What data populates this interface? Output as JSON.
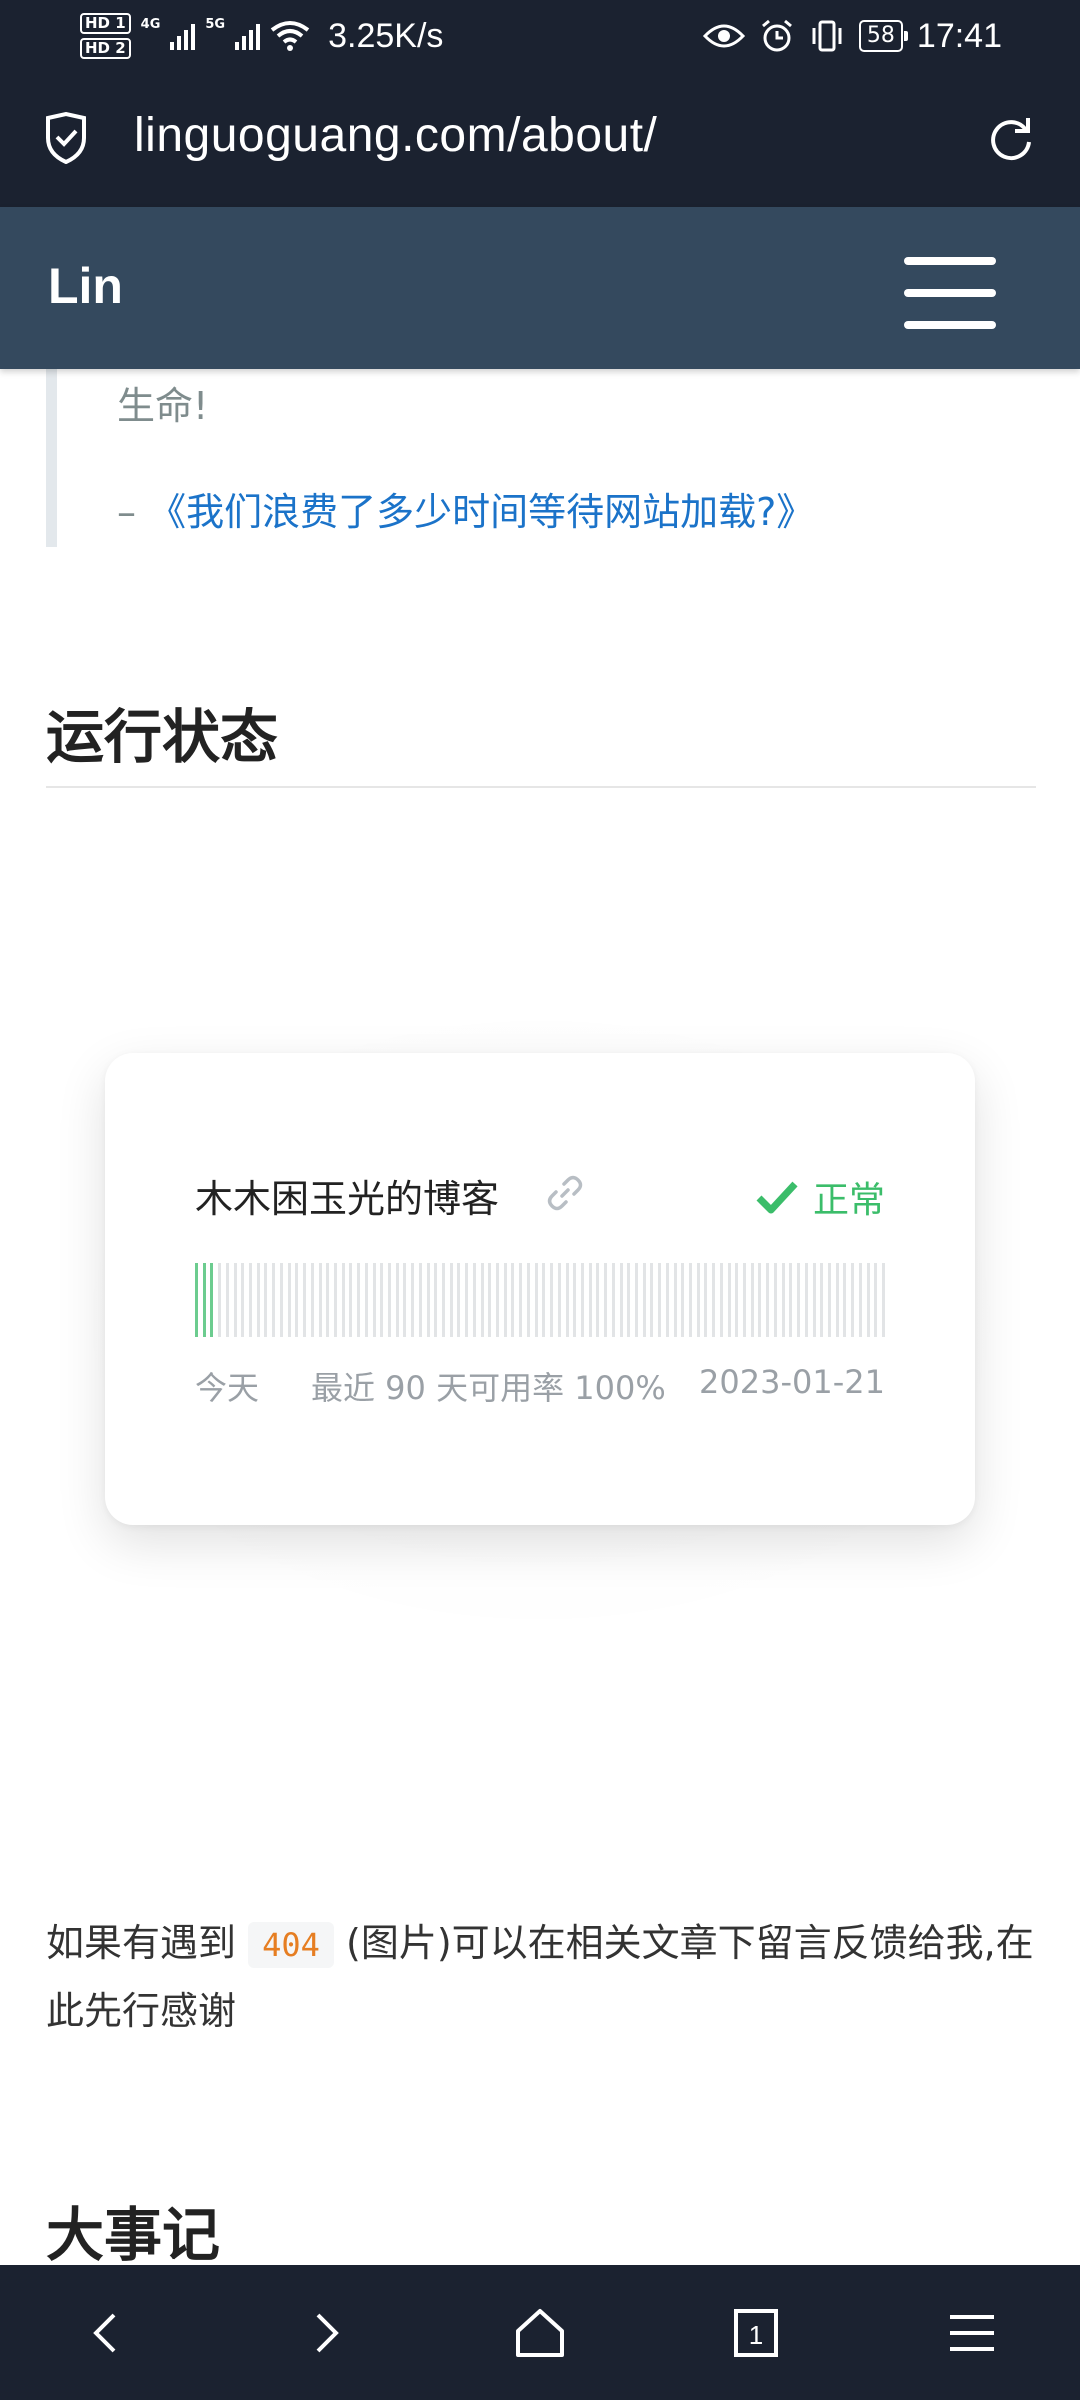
{
  "status_bar": {
    "hd1": "HD 1",
    "hd2": "HD 2",
    "net1": "4G",
    "net2": "5G",
    "speed": "3.25K/s",
    "battery": "58",
    "time": "17:41",
    "icons": [
      "eye-icon",
      "alarm-icon",
      "vibrate-icon",
      "wifi-icon",
      "signal-icon"
    ]
  },
  "browser": {
    "url": "linguoguang.com/about/"
  },
  "site_header": {
    "brand": "Lin"
  },
  "quote": {
    "text": "生命!",
    "source_prefix": "–",
    "source_link": "《我们浪费了多少时间等待网站加载?》"
  },
  "sections": {
    "running_status": "运行状态",
    "milestones": "大事记"
  },
  "monitor": {
    "name": "木木困玉光的博客",
    "status": "正常",
    "uptime_days": 90,
    "up_days_shown": 3,
    "legend_today": "今天",
    "legend_availability": "最近 90 天可用率 100%",
    "legend_date": "2023-01-21",
    "colors": {
      "up": "#6ccc8f",
      "idle": "#e2e4e6",
      "status": "#3bbd6a"
    }
  },
  "feedback": {
    "text_before": "如果有遇到",
    "code": "404",
    "text_after": "(图片)可以在相关文章下留言反馈给我,在此先行感谢"
  },
  "bottom_nav": {
    "tab_count": "1"
  }
}
